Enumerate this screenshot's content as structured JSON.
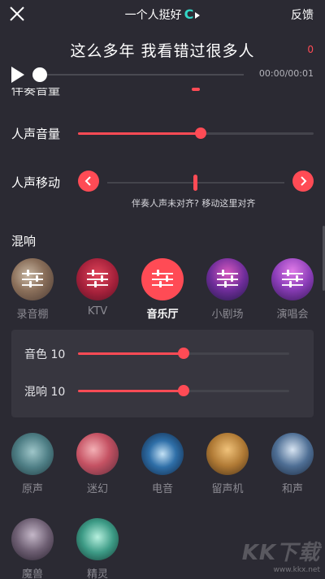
{
  "header": {
    "close_icon": "close-icon",
    "title": "一个人挺好",
    "title_logo": "C",
    "feedback_label": "反馈"
  },
  "lyric": {
    "text": "这么多年 我看错过很多人",
    "count": "0"
  },
  "player": {
    "time": "00:00/00:01",
    "progress": 0
  },
  "controls": {
    "vocal_volume_label": "人声音量",
    "vocal_volume_value": 0.52,
    "vocal_shift_label": "人声移动",
    "hint": "伴奏人声未对齐? 移动这里对齐",
    "cut_label": "伴奏音量"
  },
  "reverb": {
    "title": "混响",
    "items": [
      {
        "label": "录音棚",
        "selected": false
      },
      {
        "label": "KTV",
        "selected": false
      },
      {
        "label": "音乐厅",
        "selected": true
      },
      {
        "label": "小剧场",
        "selected": false
      },
      {
        "label": "演唱会",
        "selected": false
      }
    ],
    "tone_label": "音色 10",
    "tone_value": 0.5,
    "reverb_label": "混响 10",
    "reverb_value": 0.5
  },
  "voice_effects": {
    "items": [
      {
        "label": "原声"
      },
      {
        "label": "迷幻"
      },
      {
        "label": "电音"
      },
      {
        "label": "留声机"
      },
      {
        "label": "和声"
      },
      {
        "label": "魔兽"
      },
      {
        "label": "精灵"
      }
    ]
  },
  "watermark": {
    "logo": "KK下载",
    "url": "www.kkx.net"
  },
  "colors": {
    "accent": "#ff4b55",
    "background": "#2b2a33",
    "logo_teal": "#33d6c7"
  }
}
